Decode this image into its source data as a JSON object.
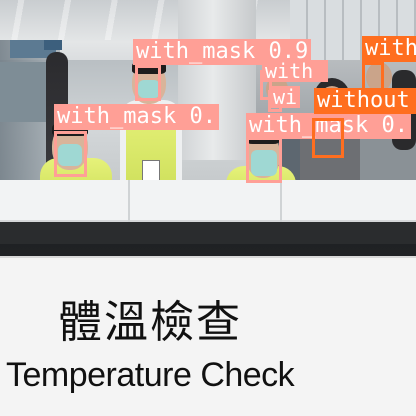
{
  "scene": {
    "sign_chinese": "體溫檢查",
    "sign_english": "Temperature Check"
  },
  "detections": [
    {
      "label": "with_mask 0.9",
      "color": "#ff9f96"
    },
    {
      "label": "with_mask 0.",
      "color": "#ff9f96"
    },
    {
      "label": "with_mask 0.",
      "color": "#ff9f96"
    },
    {
      "label": "with_",
      "color": "#ff9f96"
    },
    {
      "label": "wi",
      "color": "#ff9f96"
    },
    {
      "label": "with",
      "color": "#ff6e1f"
    },
    {
      "label": "without",
      "color": "#ff6e1f"
    }
  ]
}
